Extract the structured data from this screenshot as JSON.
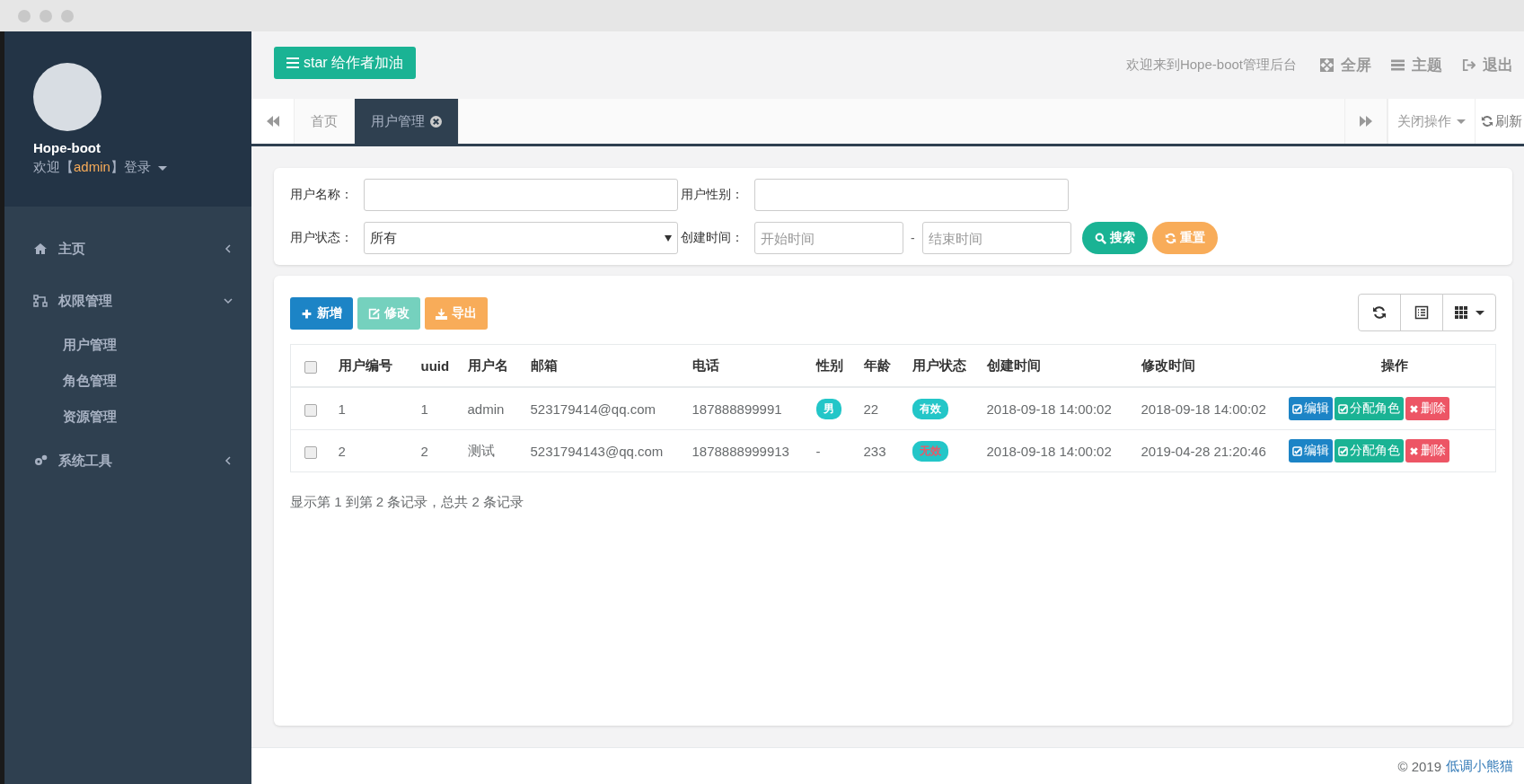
{
  "sidebar": {
    "app_name": "Hope-boot",
    "welcome_prefix": "欢迎【",
    "user": "admin",
    "welcome_suffix": "】登录",
    "menu": [
      {
        "label": "主页",
        "expanded": false
      },
      {
        "label": "权限管理",
        "expanded": true,
        "children": [
          {
            "label": "用户管理"
          },
          {
            "label": "角色管理"
          },
          {
            "label": "资源管理"
          }
        ]
      },
      {
        "label": "系统工具",
        "expanded": false
      }
    ]
  },
  "header": {
    "star_button": "star 给作者加油",
    "welcome": "欢迎来到Hope-boot管理后台",
    "actions": [
      {
        "label": "全屏"
      },
      {
        "label": "主题"
      },
      {
        "label": "退出"
      }
    ]
  },
  "tabs": [
    {
      "label": "首页",
      "selected": false,
      "closable": false
    },
    {
      "label": "用户管理",
      "selected": true,
      "closable": true
    }
  ],
  "tab_tools": {
    "close_menu": "关闭操作",
    "refresh": "刷新"
  },
  "search": {
    "fields": [
      {
        "label": "用户名称：",
        "kind": "text"
      },
      {
        "label": "用户性别：",
        "kind": "text"
      },
      {
        "label": "用户状态：",
        "kind": "select",
        "value": "所有"
      },
      {
        "label": "创建时间：",
        "kind": "range",
        "start_placeholder": "开始时间",
        "separator": "-",
        "end_placeholder": "结束时间"
      }
    ],
    "buttons": [
      {
        "label": "搜索",
        "kind": "search"
      },
      {
        "label": "重置",
        "kind": "reset"
      }
    ]
  },
  "toolbar": [
    {
      "label": "新增",
      "kind": "add",
      "disabled": false
    },
    {
      "label": "修改",
      "kind": "edit",
      "disabled": true
    },
    {
      "label": "导出",
      "kind": "export",
      "disabled": false
    }
  ],
  "table": {
    "columns": [
      "用户编号",
      "uuid",
      "用户名",
      "邮箱",
      "电话",
      "性别",
      "年龄",
      "用户状态",
      "创建时间",
      "修改时间",
      "操作"
    ],
    "rows": [
      {
        "checked": false,
        "id": "1",
        "uuid": "1",
        "name": "admin",
        "email": "523179414@qq.com",
        "phone": "187888899991",
        "gender": {
          "text": "男",
          "kind": "badge"
        },
        "age": "22",
        "status": {
          "text": "有效",
          "kind": "valid"
        },
        "created": "2018-09-18 14:00:02",
        "modified": "2018-09-18 14:00:02",
        "ops": [
          {
            "label": "编辑",
            "kind": "edit"
          },
          {
            "label": "分配角色",
            "kind": "assign"
          },
          {
            "label": "删除",
            "kind": "delete"
          }
        ]
      },
      {
        "checked": false,
        "id": "2",
        "uuid": "2",
        "name": "测试",
        "email": "5231794143@qq.com",
        "phone": "1878888999913",
        "gender": {
          "text": "-",
          "kind": "plain"
        },
        "age": "233",
        "status": {
          "text": "无效",
          "kind": "invalid"
        },
        "created": "2018-09-18 14:00:02",
        "modified": "2019-04-28 21:20:46",
        "ops": [
          {
            "label": "编辑",
            "kind": "edit"
          },
          {
            "label": "分配角色",
            "kind": "assign"
          },
          {
            "label": "删除",
            "kind": "delete"
          }
        ]
      }
    ],
    "all_checked": false
  },
  "pagination": "显示第 1 到第 2 条记录，总共 2 条记录",
  "footer": {
    "copyright": "© 2019",
    "author": "低调小熊猫"
  }
}
